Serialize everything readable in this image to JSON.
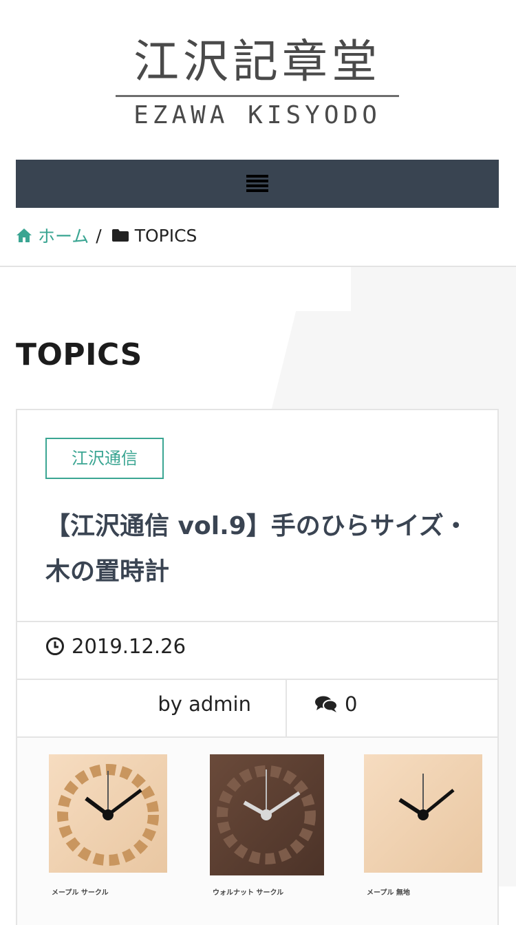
{
  "header": {
    "logo_jp": "江沢記章堂",
    "logo_en": "EZAWA KISYODO"
  },
  "nav": {
    "menu_icon": "hamburger-menu-icon"
  },
  "breadcrumb": {
    "home_label": "ホーム",
    "separator": "/",
    "current_label": "TOPICS",
    "home_icon": "home-icon",
    "folder_icon": "folder-icon"
  },
  "page": {
    "title": "TOPICS"
  },
  "post": {
    "category": "江沢通信",
    "title": "【江沢通信 vol.9】手のひらサイズ・木の置時計",
    "date": "2019.12.26",
    "author": "by admin",
    "comment_count": "0",
    "captions": [
      "メープル サークル",
      "ウォルナット サークル",
      "メープル 無地"
    ]
  },
  "colors": {
    "accent": "#3aa592",
    "nav_bg": "#394451",
    "title_color": "#3a4452"
  }
}
